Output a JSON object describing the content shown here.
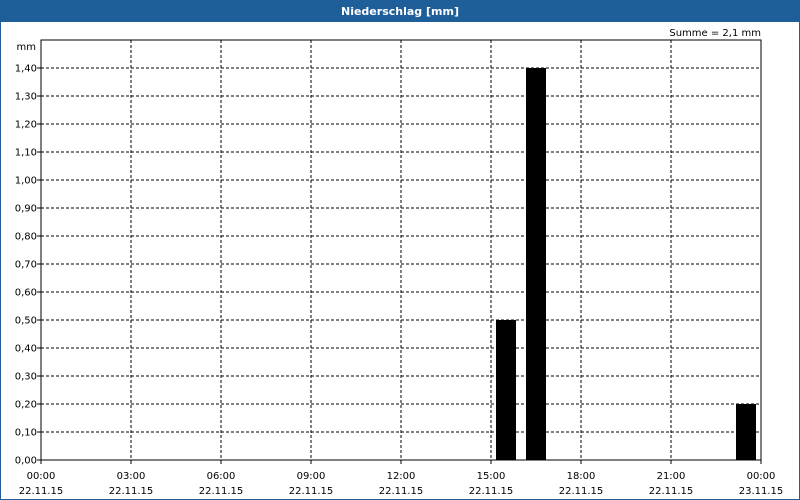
{
  "window": {
    "title": "Niederschlag [mm]"
  },
  "chart_data": {
    "type": "bar",
    "title": "Niederschlag [mm]",
    "ylabel": "mm",
    "summary": "Summe = 2,1 mm",
    "ylim": [
      0,
      1.5
    ],
    "yticks": [
      "0,00",
      "0,10",
      "0,20",
      "0,30",
      "0,40",
      "0,50",
      "0,60",
      "0,70",
      "0,80",
      "0,90",
      "1,00",
      "1,10",
      "1,20",
      "1,30",
      "1,40"
    ],
    "xticks": [
      {
        "time": "00:00",
        "date": "22.11.15"
      },
      {
        "time": "03:00",
        "date": "22.11.15"
      },
      {
        "time": "06:00",
        "date": "22.11.15"
      },
      {
        "time": "09:00",
        "date": "22.11.15"
      },
      {
        "time": "12:00",
        "date": "22.11.15"
      },
      {
        "time": "15:00",
        "date": "22.11.15"
      },
      {
        "time": "18:00",
        "date": "22.11.15"
      },
      {
        "time": "21:00",
        "date": "22.11.15"
      },
      {
        "time": "00:00",
        "date": "23.11.15"
      }
    ],
    "grid": true,
    "bar_color": "#000000",
    "series": [
      {
        "values": [
          {
            "x": "22.11.15 15:00",
            "y": 0.5
          },
          {
            "x": "22.11.15 16:00",
            "y": 1.4
          },
          {
            "x": "22.11.15 23:00",
            "y": 0.2
          }
        ]
      }
    ]
  }
}
